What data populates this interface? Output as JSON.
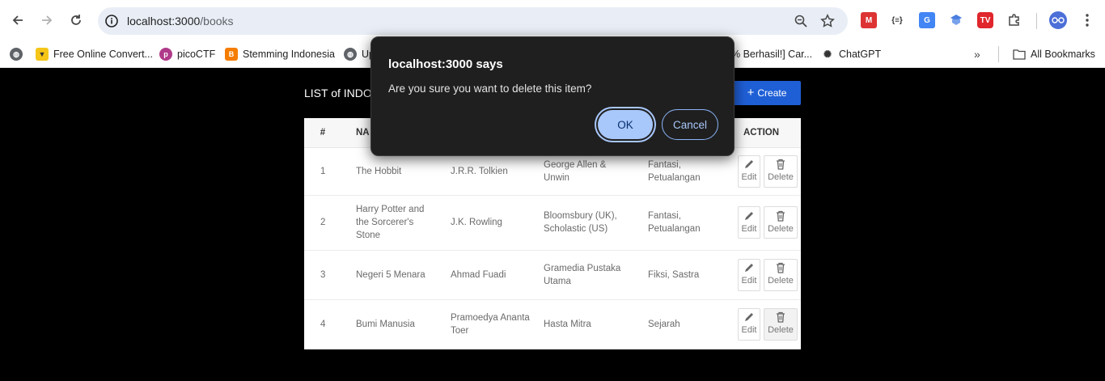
{
  "browser": {
    "url_host": "localhost:3000",
    "url_path": "/books",
    "bookmarks": [
      {
        "label": "Free Online Convert...",
        "icon": "free-online-convert-favicon"
      },
      {
        "label": "picoCTF",
        "icon": "picoctf-favicon"
      },
      {
        "label": "Stemming Indonesia",
        "icon": "blogger-favicon"
      },
      {
        "label": "Up",
        "icon": "globe-favicon"
      },
      {
        "label": "% Berhasil!] Car...",
        "icon": "none"
      },
      {
        "label": "ChatGPT",
        "icon": "chatgpt-favicon"
      }
    ],
    "all_bookmarks_label": "All Bookmarks"
  },
  "page": {
    "title": "LIST of INDON",
    "create_label": "Create"
  },
  "table": {
    "headers": [
      "#",
      "NA",
      "",
      "",
      "",
      "ACTION"
    ],
    "rows": [
      {
        "num": "1",
        "name": "The Hobbit",
        "author": "J.R.R. Tolkien",
        "publisher": "George Allen & Unwin",
        "genre": "Fantasi, Petualangan"
      },
      {
        "num": "2",
        "name": "Harry Potter and the Sorcerer's Stone",
        "author": "J.K. Rowling",
        "publisher": "Bloomsbury (UK), Scholastic (US)",
        "genre": "Fantasi, Petualangan"
      },
      {
        "num": "3",
        "name": "Negeri 5 Menara",
        "author": "Ahmad Fuadi",
        "publisher": "Gramedia Pustaka Utama",
        "genre": "Fiksi, Sastra"
      },
      {
        "num": "4",
        "name": "Bumi Manusia",
        "author": "Pramoedya Ananta Toer",
        "publisher": "Hasta Mitra",
        "genre": "Sejarah"
      }
    ],
    "edit_label": "Edit",
    "delete_label": "Delete"
  },
  "dialog": {
    "title": "localhost:3000 says",
    "message": "Are you sure you want to delete this item?",
    "ok_label": "OK",
    "cancel_label": "Cancel"
  },
  "colors": {
    "create_button": "#1f5fd6",
    "ok_button": "#a8c7fa",
    "dialog_bg": "#1f1f1f"
  }
}
